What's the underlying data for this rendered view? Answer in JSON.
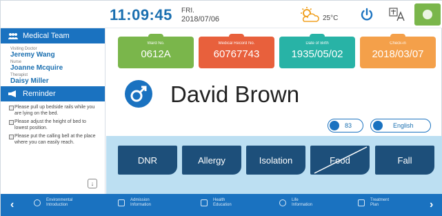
{
  "header": {
    "time": "11:09:45",
    "day": "FRI.",
    "date": "2018/07/06",
    "temperature": "25°C"
  },
  "sidebar": {
    "team_title": "Medical Team",
    "staff": [
      {
        "role": "Visiting Doctor",
        "name": "Jeremy Wang"
      },
      {
        "role": "Nurse",
        "name": "Joanne Mcquire"
      },
      {
        "role": "Therapist",
        "name": "Daisy Miller"
      }
    ],
    "reminder_title": "Reminder",
    "reminders": [
      "Please pull up bedside rails while you are lying on the bed.",
      "Please adjust the height of bed to lowest position.",
      "Please put the calling bell at the place where you can easily reach."
    ]
  },
  "tiles": [
    {
      "label": "Ward No.",
      "value": "0612A",
      "color": "#7ab64b"
    },
    {
      "label": "Medical Record No.",
      "value": "60767743",
      "color": "#e8603c"
    },
    {
      "label": "Date of Birth",
      "value": "1935/05/02",
      "color": "#28b3a6"
    },
    {
      "label": "Check-in",
      "value": "2018/03/07",
      "color": "#f4a04a"
    }
  ],
  "patient": {
    "name": "David Brown",
    "count": "83",
    "language": "English"
  },
  "alerts": [
    "DNR",
    "Allergy",
    "Isolation",
    "Food",
    "Fall"
  ],
  "bottom_nav": [
    {
      "line1": "Environmental",
      "line2": "Introduction"
    },
    {
      "line1": "Admission",
      "line2": "Information"
    },
    {
      "line1": "Health",
      "line2": "Education"
    },
    {
      "line1": "Life",
      "line2": "Information"
    },
    {
      "line1": "Treatment",
      "line2": "Plan"
    }
  ],
  "colors": {
    "primary": "#1a72c0",
    "alert_bg": "#1d4f7a",
    "band": "#bcdff2"
  }
}
